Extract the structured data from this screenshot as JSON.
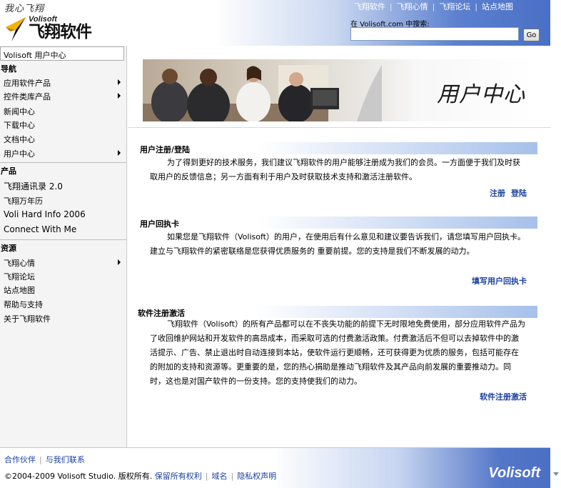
{
  "header": {
    "logo_script": "我心飞翔",
    "logo_brand": "Volisoft",
    "logo_cn": "飞翔软件",
    "nav": [
      "飞翔软件",
      "飞翔心情",
      "飞翔论坛",
      "站点地图"
    ],
    "search_label": "在 Volisoft.com 中搜索:",
    "search_value": "",
    "search_button": "Go"
  },
  "sidebar": {
    "user_center": "Volisoft 用户中心",
    "nav_heading": "导航",
    "nav_items": [
      "应用软件产品",
      "控件类库产品",
      "新闻中心",
      "下载中心",
      "文档中心",
      "用户中心"
    ],
    "products_heading": "产品",
    "product_items": [
      "飞翔通讯录 2.0",
      "飞翔万年历",
      "Voli Hard Info 2006",
      "Connect With Me"
    ],
    "resources_heading": "资源",
    "resource_items": [
      "飞翔心情",
      "飞翔论坛",
      "站点地图",
      "帮助与支持",
      "关于飞翔软件"
    ]
  },
  "main": {
    "banner_title": "用户中心",
    "sections": [
      {
        "title": "用户注册/登陆",
        "text": "为了得到更好的技术服务，我们建议飞翔软件的用户能够注册成为我们的会员。一方面便于我们及时获取用户的反馈信息；另一方面有利于用户及时获取技术支持和激活注册软件。",
        "links": [
          "注册",
          "登陆"
        ]
      },
      {
        "title": "用户回执卡",
        "text": "如果您是飞翔软件（Volisoft）的用户，在使用后有什么意见和建议要告诉我们，请您填写用户回执卡。建立与飞翔软件的紧密联络是您获得优质服务的 重要前提。您的支持是我们不断发展的动力。",
        "links": [
          "填写用户回执卡"
        ]
      },
      {
        "title": "软件注册激活",
        "text": "飞翔软件（Volisoft）的所有产品都可以在不丧失功能的前提下无时限地免费使用，部分应用软件产品为了收回维护网站和开发软件的高昂成本，而采取可选的付费激活政策。付费激活后不但可以去掉软件中的激活提示、广告、禁止退出时自动连接到本站，使软件运行更顺畅，还可获得更为优质的服务，包括可能存在的附加的支持和资源等。更重要的是，您的热心捐助是推动飞翔软件及其产品向前发展的重要推动力。同时，这也是对国产软件的一份支持。您的支持使我们的动力。",
        "links": [
          "软件注册激活"
        ]
      }
    ]
  },
  "footer": {
    "links": [
      "合作伙伴",
      "与我们联系"
    ],
    "copyright": "©2004-2009 Volisoft Studio. 版权所有.",
    "copy_links": [
      "保留所有权利",
      "域名",
      "隐私权声明"
    ],
    "brand": "Volisoft"
  },
  "colors": {
    "link": "#1a3fa0",
    "header_blue": "#4a70c6",
    "section_bar": "#a6c0ea"
  },
  "icons": [
    "volisoft-logo-icon",
    "submenu-arrow-icon",
    "scroll-down-icon"
  ]
}
